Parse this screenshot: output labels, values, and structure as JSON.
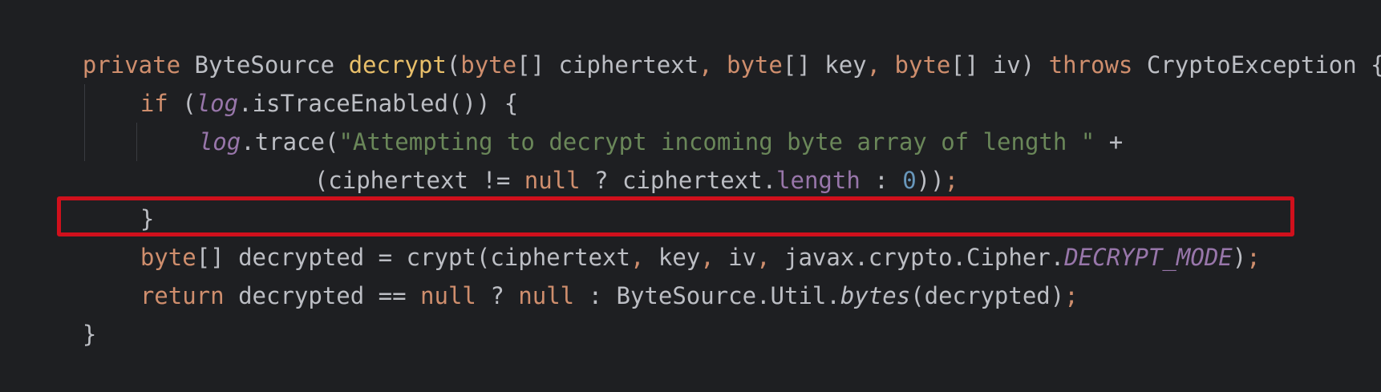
{
  "editor": {
    "lines": {
      "l1": {
        "t1": "private",
        "t2": " ByteSource ",
        "t3": "decrypt",
        "t4": "(",
        "t5": "byte",
        "t6": "[] ciphertext",
        "t7": ", ",
        "t8": "byte",
        "t9": "[] key",
        "t10": ", ",
        "t11": "byte",
        "t12": "[] iv) ",
        "t13": "throws",
        "t14": " CryptoException {"
      },
      "l2": {
        "t1": "if",
        "t2": " (",
        "t3": "log",
        "t4": ".isTraceEnabled()) {"
      },
      "l3": {
        "t1": "log",
        "t2": ".trace(",
        "t3": "\"Attempting to decrypt incoming byte array of length \"",
        "t4": " +"
      },
      "l4": {
        "t1": "(ciphertext != ",
        "t2": "null",
        "t3": " ? ciphertext.",
        "t4": "length",
        "t5": " : ",
        "t6": "0",
        "t7": "))",
        "t8": ";"
      },
      "l5": {
        "t1": "}"
      },
      "l6": {
        "t1": "byte",
        "t2": "[] decrypted = crypt(ciphertext",
        "t3": ", ",
        "t4": "key",
        "t5": ", ",
        "t6": "iv",
        "t7": ", ",
        "t8": "javax.crypto.Cipher.",
        "t9": "DECRYPT_MODE",
        "t10": ")",
        "t11": ";"
      },
      "l7": {
        "t1": "return",
        "t2": " decrypted == ",
        "t3": "null",
        "t4": " ? ",
        "t5": "null",
        "t6": " : ByteSource.Util.",
        "t7": "bytes",
        "t8": "(decrypted)",
        "t9": ";"
      },
      "l8": {
        "t1": "}"
      }
    }
  },
  "colors": {
    "background": "#1e1f22",
    "keyword": "#cf8e6d",
    "method_declaration": "#e8bf6a",
    "string": "#6a8759",
    "number": "#6897bb",
    "field": "#9876aa",
    "default_text": "#bcbec4",
    "highlight_border": "#d0101c"
  }
}
